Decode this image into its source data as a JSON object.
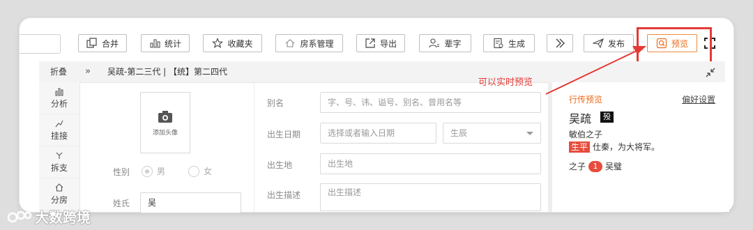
{
  "toolbar": {
    "buttons": [
      {
        "label": "合并",
        "icon": "merge-icon"
      },
      {
        "label": "统计",
        "icon": "bar-chart-icon"
      },
      {
        "label": "收藏夹",
        "icon": "star-icon"
      },
      {
        "label": "房系管理",
        "icon": "house-icon"
      },
      {
        "label": "导出",
        "icon": "export-icon"
      },
      {
        "label": "辈字",
        "icon": "user-icon"
      },
      {
        "label": "生成",
        "icon": "document-icon"
      },
      {
        "label": "",
        "icon": "double-chevron-right-icon"
      },
      {
        "label": "发布",
        "icon": "send-icon"
      },
      {
        "label": "预览",
        "icon": "preview-icon"
      }
    ],
    "expand_icon": "fullscreen-icon"
  },
  "bar": {
    "fold_label": "折叠",
    "breadcrumb": "吴疏-第二三代 | 【统】第二四代"
  },
  "sidebar": {
    "items": [
      {
        "label": "分析",
        "icon": "analysis-icon"
      },
      {
        "label": "挂接",
        "icon": "link-icon"
      },
      {
        "label": "拆支",
        "icon": "split-icon"
      },
      {
        "label": "分房",
        "icon": "house-icon"
      }
    ]
  },
  "form": {
    "avatar_label": "添加头像",
    "gender_label": "性别",
    "gender_options": [
      "男",
      "女"
    ],
    "surname_label": "姓氏",
    "surname_value": "吴",
    "alias_label": "别名",
    "alias_placeholder": "字、号、讳、谥号、别名、曾用名等",
    "birth_date_label": "出生日期",
    "birth_date_placeholder": "选择或者输入日期",
    "birth_hour_value": "生辰",
    "birth_place_label": "出生地",
    "birth_place_placeholder": "出生地",
    "birth_desc_label": "出生描述",
    "birth_desc_placeholder": "出生描述"
  },
  "preview_panel": {
    "title": "行传预览",
    "settings_link": "偏好设置",
    "name": "吴疏",
    "badge": "殁",
    "line1": "敏伯之子",
    "tag": "生平",
    "line2": "仕秦，为大将军。",
    "children_label": "之子",
    "children_count": "1",
    "child_name": "吴璧"
  },
  "annotation": "可以实时预览",
  "watermark": "大数跨境",
  "colors": {
    "accent": "#ef6a1a",
    "annotation": "#e53935",
    "tag": "#e74c3c"
  }
}
